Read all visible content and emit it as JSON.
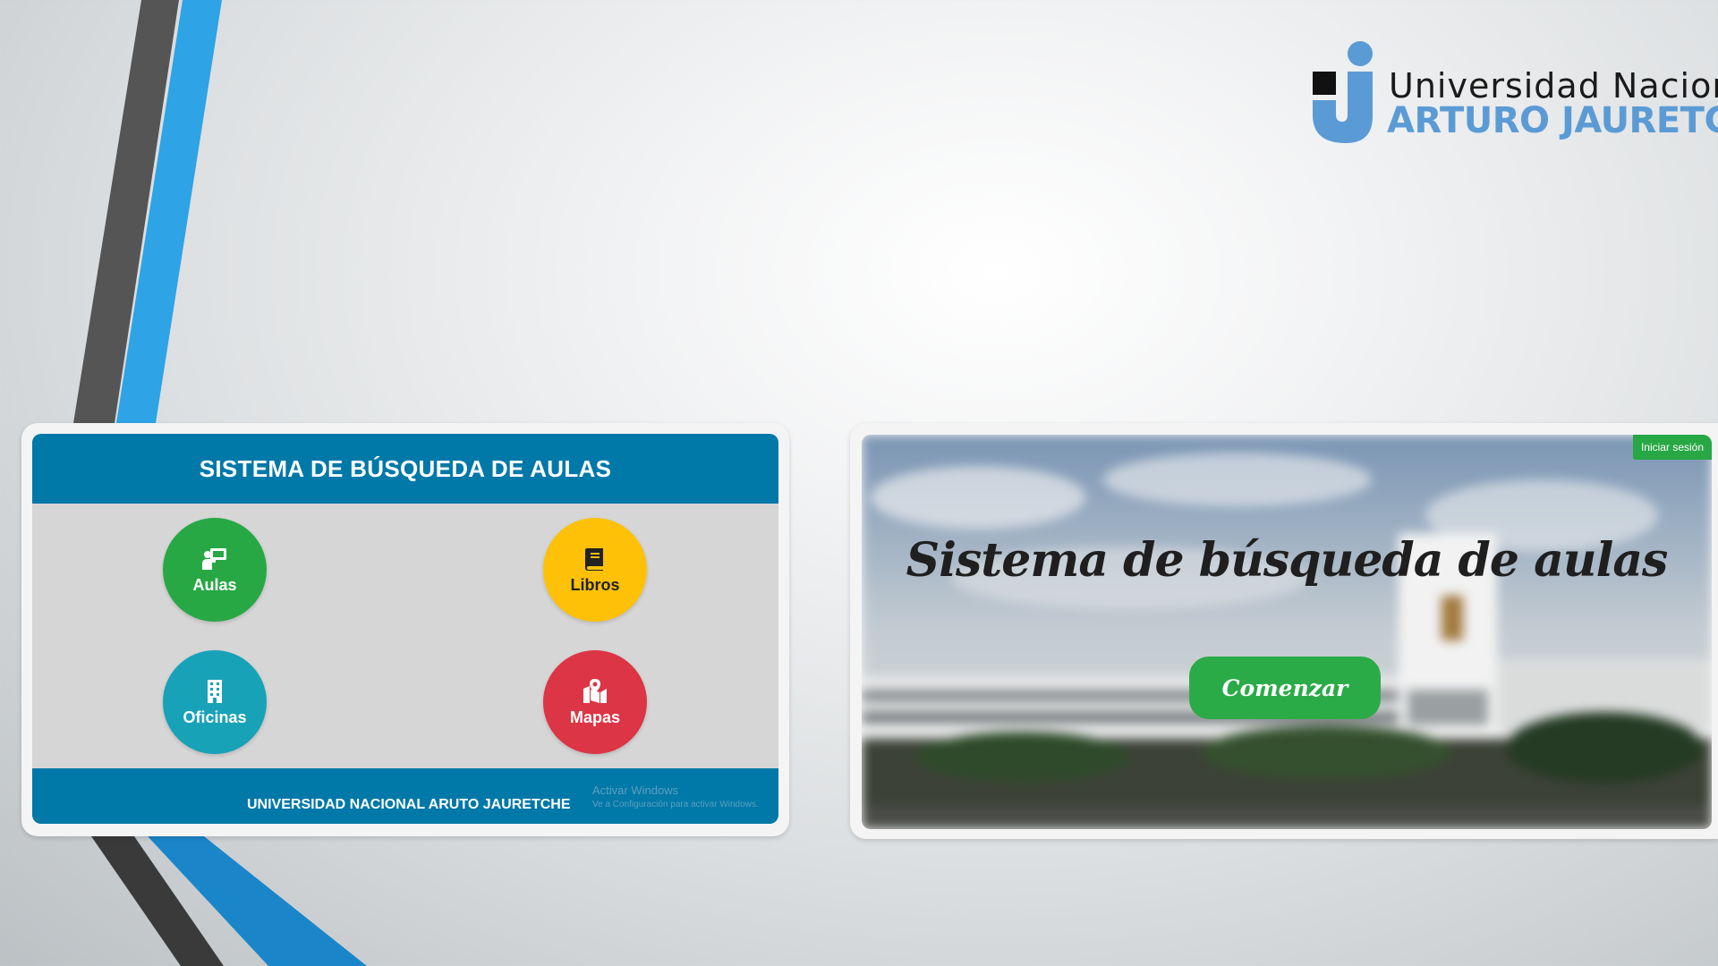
{
  "logo": {
    "line1": "Universidad Nacional",
    "line2": "ARTURO JAURETCHE",
    "colors": {
      "blue": "#5b9bd5",
      "black": "#111111"
    }
  },
  "left_screenshot": {
    "header_title": "SISTEMA DE BÚSQUEDA DE AULAS",
    "tiles": [
      {
        "label": "Aulas",
        "icon": "chalkboard-teacher-icon",
        "color": "#27a844"
      },
      {
        "label": "Libros",
        "icon": "book-icon",
        "color": "#ffc107"
      },
      {
        "label": "Oficinas",
        "icon": "building-icon",
        "color": "#17a2b8"
      },
      {
        "label": "Mapas",
        "icon": "map-marked-icon",
        "color": "#dc3545"
      }
    ],
    "footer_text": "UNIVERSIDAD NACIONAL ARUTO JAURETCHE",
    "activate_windows": "Activar Windows",
    "activate_windows_sub": "Ve a Configuración para activar Windows.",
    "accent_color": "#0078a8"
  },
  "right_screenshot": {
    "login_button": "Iniciar sesión",
    "hero_title": "Sistema de búsqueda de aulas",
    "start_button": "Comenzar",
    "accent_color": "#2bab48"
  }
}
